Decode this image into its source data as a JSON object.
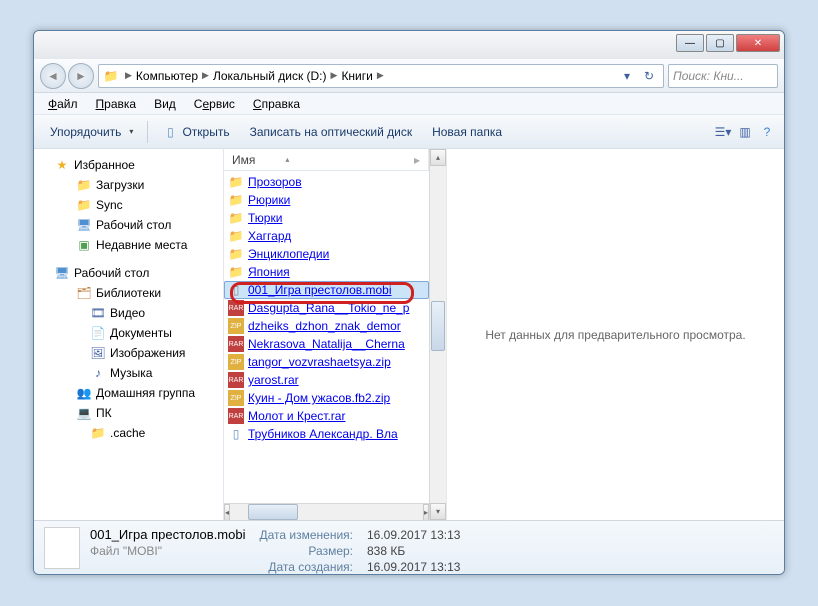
{
  "titlebar": {
    "min": "—",
    "max": "▢",
    "close": "✕"
  },
  "breadcrumbs": [
    "Компьютер",
    "Локальный диск (D:)",
    "Книги"
  ],
  "search": {
    "placeholder": "Поиск: Кни..."
  },
  "menu": {
    "file": "Файл",
    "edit": "Правка",
    "view": "Вид",
    "tools": "Сервис",
    "help": "Справка"
  },
  "toolbar": {
    "organize": "Упорядочить",
    "open": "Открыть",
    "burn": "Записать на оптический диск",
    "newfolder": "Новая папка"
  },
  "sidebar": {
    "favorites": "Избранное",
    "downloads": "Загрузки",
    "sync": "Sync",
    "desktop": "Рабочий стол",
    "recent": "Недавние места",
    "desktop2": "Рабочий стол",
    "libraries": "Библиотеки",
    "video": "Видео",
    "documents": "Документы",
    "pictures": "Изображения",
    "music": "Музыка",
    "homegroup": "Домашняя группа",
    "pc": "ПК",
    "cache": ".cache"
  },
  "column": {
    "name": "Имя"
  },
  "files": {
    "f0": "Прозоров",
    "f1": "Рюрики",
    "f2": "Тюрки",
    "f3": "Хаггард",
    "f4": "Энциклопедии",
    "f5": "Япония",
    "f6": "001_Игра престолов.mobi",
    "f7": "Dasgupta_Rana__Tokio_ne_p",
    "f8": "dzheiks_dzhon_znak_demor",
    "f9": "Nekrasova_Natalija__Cherna",
    "f10": "tangor_vozvrashaetsya.zip",
    "f11": "yarost.rar",
    "f12": "Куин - Дом ужасов.fb2.zip",
    "f13": "Молот и Крест.rar",
    "f14": "Трубников Александр. Вла"
  },
  "preview": {
    "empty": "Нет данных для предварительного просмотра."
  },
  "status": {
    "filename": "001_Игра престолов.mobi",
    "type": "Файл \"MOBI\"",
    "modified_label": "Дата изменения:",
    "modified": "16.09.2017 13:13",
    "size_label": "Размер:",
    "size": "838 КБ",
    "created_label": "Дата создания:",
    "created": "16.09.2017 13:13"
  }
}
